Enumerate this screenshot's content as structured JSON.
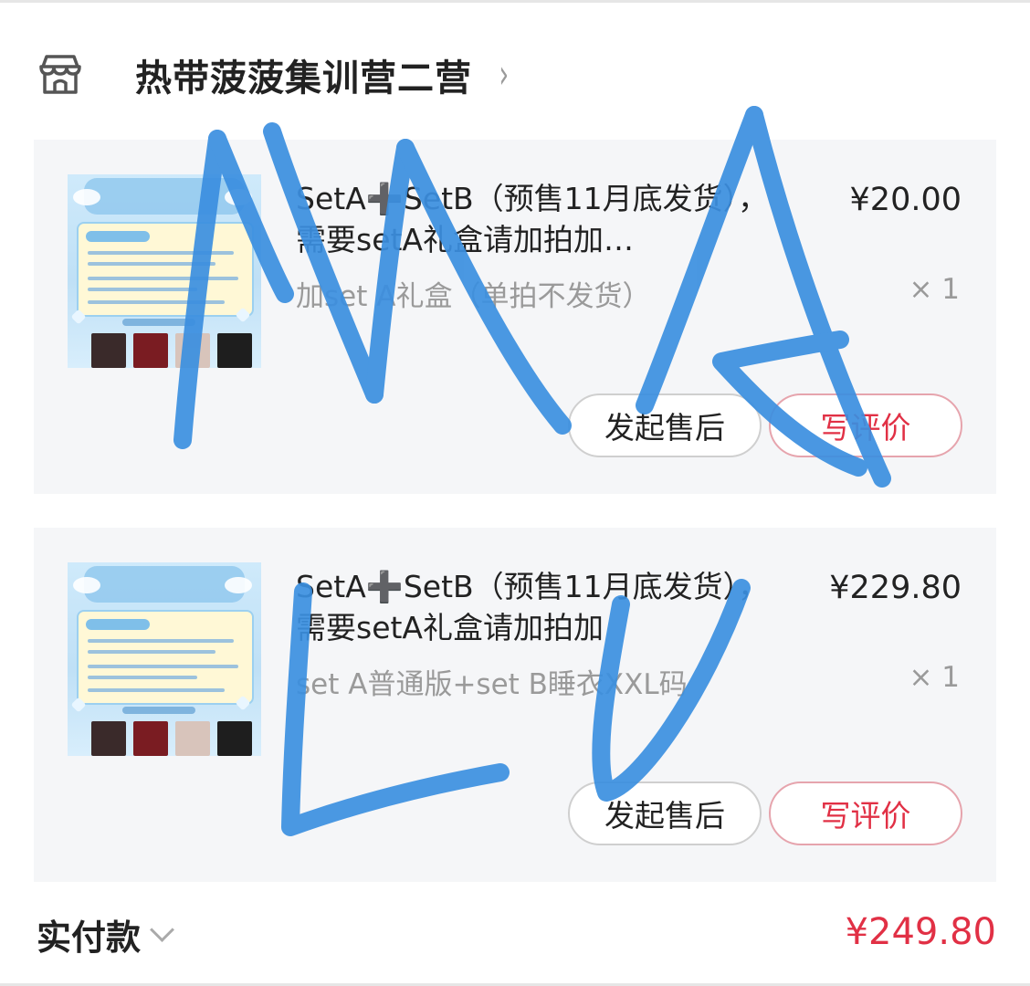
{
  "shop": {
    "name": "热带菠菠集训营二营",
    "chevron": "›"
  },
  "orders": [
    {
      "title": "SetA➕SetB（预售11月底发货），需要setA礼盒请加拍加…",
      "price": "¥20.00",
      "sku": "加set A礼盒（单拍不发货）",
      "qty": "× 1",
      "aftersale_label": "发起售后",
      "review_label": "写评价"
    },
    {
      "title": "SetA➕SetB（预售11月底发货），需要setA礼盒请加拍加",
      "price": "¥229.80",
      "sku": "set A普通版+set B睡衣XXL码",
      "qty": "× 1",
      "aftersale_label": "发起售后",
      "review_label": "写评价"
    }
  ],
  "summary": {
    "paid_label": "实付款",
    "paid_amount": "¥249.80"
  },
  "colors": {
    "accent": "#e13045",
    "scribble": "#3b8fe0",
    "card_bg": "#f5f6f8"
  }
}
